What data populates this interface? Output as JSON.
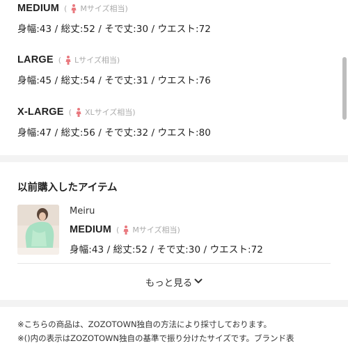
{
  "sizes": [
    {
      "name": "MEDIUM",
      "hint": "Mサイズ相当",
      "measurements": "身幅:43 / 総丈:52 / そで丈:30 / ウエスト:72"
    },
    {
      "name": "LARGE",
      "hint": "Lサイズ相当",
      "measurements": "身幅:45 / 総丈:54 / そで丈:31 / ウエスト:76"
    },
    {
      "name": "X-LARGE",
      "hint": "XLサイズ相当",
      "measurements": "身幅:47 / 総丈:56 / そで丈:32 / ウエスト:80"
    }
  ],
  "history": {
    "title": "以前購入したアイテム",
    "item": {
      "brand": "Meiru",
      "size": "MEDIUM",
      "hint": "Mサイズ相当",
      "measurements": "身幅:43 / 総丈:52 / そで丈:30 / ウエスト:72"
    },
    "more_label": "もっと見る"
  },
  "notes": [
    "※こちらの商品は、ZOZOTOWN独自の方法により採寸しております。",
    "※()内の表示はZOZOTOWN独自の基準で振り分けたサイズです。ブランド表"
  ],
  "icons": {
    "person": "person-icon",
    "chevron": "chevron-down-icon"
  },
  "colors": {
    "person_icon": "#e9797f",
    "divider": "#f3f3f3",
    "thumb_top": "#efe6dd",
    "thumb_garment": "#a8e0c3"
  }
}
